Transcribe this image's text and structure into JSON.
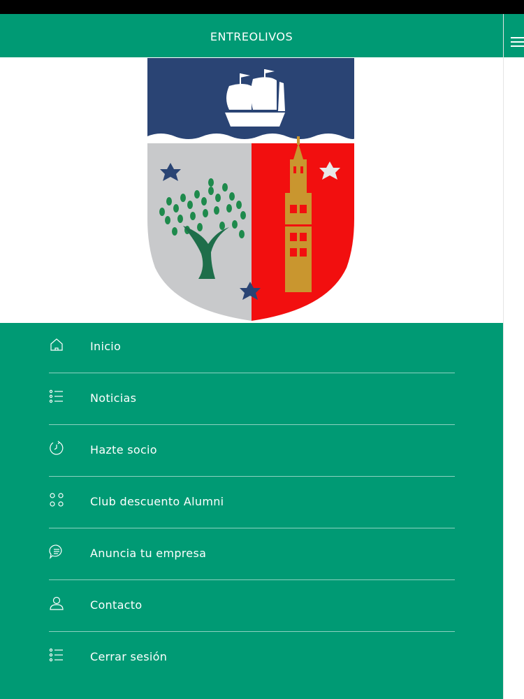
{
  "app": {
    "title": "ENTREOLIVOS"
  },
  "menu": {
    "items": [
      {
        "label": "Inicio",
        "icon": "home-icon"
      },
      {
        "label": "Noticias",
        "icon": "list-icon"
      },
      {
        "label": "Hazte socio",
        "icon": "clock-icon"
      },
      {
        "label": "Club descuento Alumni",
        "icon": "grid-icon"
      },
      {
        "label": "Anuncia tu empresa",
        "icon": "chat-bubble-icon"
      },
      {
        "label": "Contacto",
        "icon": "user-icon"
      },
      {
        "label": "Cerrar sesión",
        "icon": "list-icon"
      }
    ]
  },
  "colors": {
    "primary": "#009A74",
    "crest_blue": "#2A4474",
    "crest_red": "#F20F0F",
    "crest_grey": "#C8C9CB",
    "tower_gold": "#C9962F",
    "tree_green": "#1E8A4C"
  }
}
